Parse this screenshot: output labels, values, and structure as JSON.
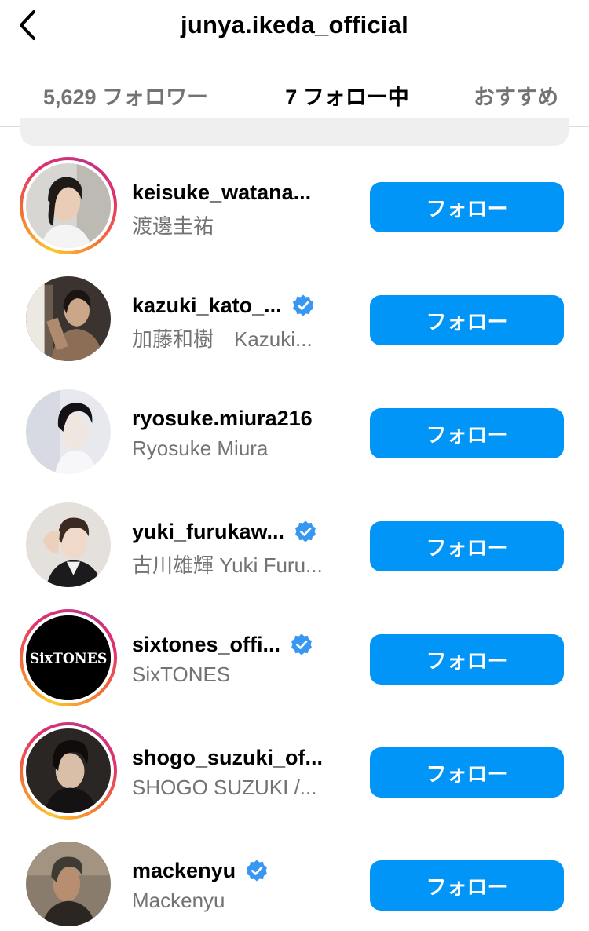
{
  "header": {
    "title": "junya.ikeda_official",
    "back_icon": "chevron-left-icon"
  },
  "tabs": [
    {
      "label": "5,629 フォロワー",
      "active": false
    },
    {
      "label": "7 フォロー中",
      "active": true
    },
    {
      "label": "おすすめ",
      "active": false
    }
  ],
  "colors": {
    "follow_button": "#0095f6",
    "verified_badge": "#3897f0",
    "secondary_text": "#737373"
  },
  "users": [
    {
      "username": "keisuke_watana...",
      "fullname": "渡邊圭祐",
      "verified": false,
      "story_ring": true,
      "button": "フォロー"
    },
    {
      "username": "kazuki_kato_...",
      "fullname": "加藤和樹　Kazuki...",
      "verified": true,
      "story_ring": false,
      "button": "フォロー"
    },
    {
      "username": "ryosuke.miura216",
      "fullname": "Ryosuke Miura",
      "verified": false,
      "story_ring": false,
      "button": "フォロー"
    },
    {
      "username": "yuki_furukaw...",
      "fullname": "古川雄輝 Yuki Furu...",
      "verified": true,
      "story_ring": false,
      "button": "フォロー"
    },
    {
      "username": "sixtones_offi...",
      "fullname": "SixTONES",
      "verified": true,
      "story_ring": true,
      "avatar_text": "SixTONES",
      "button": "フォロー"
    },
    {
      "username": "shogo_suzuki_of...",
      "fullname": "SHOGO SUZUKI /...",
      "verified": false,
      "story_ring": true,
      "button": "フォロー"
    },
    {
      "username": "mackenyu",
      "fullname": "Mackenyu",
      "verified": true,
      "story_ring": false,
      "button": "フォロー"
    }
  ]
}
